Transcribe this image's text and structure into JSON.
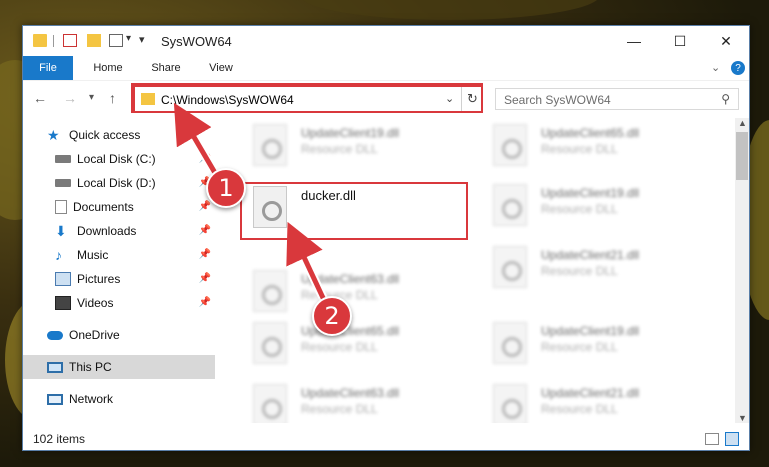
{
  "window": {
    "title": "SysWOW64",
    "minimize": "—",
    "maximize": "☐",
    "close": "✕"
  },
  "ribbon": {
    "tabs": [
      "File",
      "Home",
      "Share",
      "View"
    ]
  },
  "address": {
    "path": "C:\\Windows\\SysWOW64",
    "search_placeholder": "Search SysWOW64"
  },
  "nav": {
    "items": [
      {
        "label": "Quick access",
        "pinned": false
      },
      {
        "label": "Local Disk (C:)",
        "pinned": true
      },
      {
        "label": "Local Disk (D:)",
        "pinned": true
      },
      {
        "label": "Documents",
        "pinned": true
      },
      {
        "label": "Downloads",
        "pinned": true
      },
      {
        "label": "Music",
        "pinned": true
      },
      {
        "label": "Pictures",
        "pinned": true
      },
      {
        "label": "Videos",
        "pinned": true
      },
      {
        "label": "OneDrive",
        "pinned": false
      },
      {
        "label": "This PC",
        "pinned": false,
        "selected": true
      },
      {
        "label": "Network",
        "pinned": false
      }
    ]
  },
  "files": {
    "left_column": [
      {
        "name": "UpdateClient19.dll",
        "type": "Resource DLL"
      },
      {
        "name": "ducker.dll",
        "type": ""
      },
      {
        "name": "UpdateClient63.dll",
        "type": "Resource DLL"
      },
      {
        "name": "UpdateClient65.dll",
        "type": "Resource DLL"
      },
      {
        "name": "UpdateClient63.dll",
        "type": "Resource DLL"
      }
    ],
    "right_column": [
      {
        "name": "UpdateClient65.dll",
        "type": "Resource DLL"
      },
      {
        "name": "UpdateClient19.dll",
        "type": "Resource DLL"
      },
      {
        "name": "UpdateClient21.dll",
        "type": "Resource DLL"
      },
      {
        "name": "UpdateClient19.dll",
        "type": "Resource DLL"
      },
      {
        "name": "UpdateClient21.dll",
        "type": "Resource DLL"
      }
    ]
  },
  "status": {
    "item_count": "102 items"
  },
  "callouts": [
    "1",
    "2"
  ],
  "colors": {
    "accent": "#1979ca",
    "highlight": "#d9383c"
  }
}
